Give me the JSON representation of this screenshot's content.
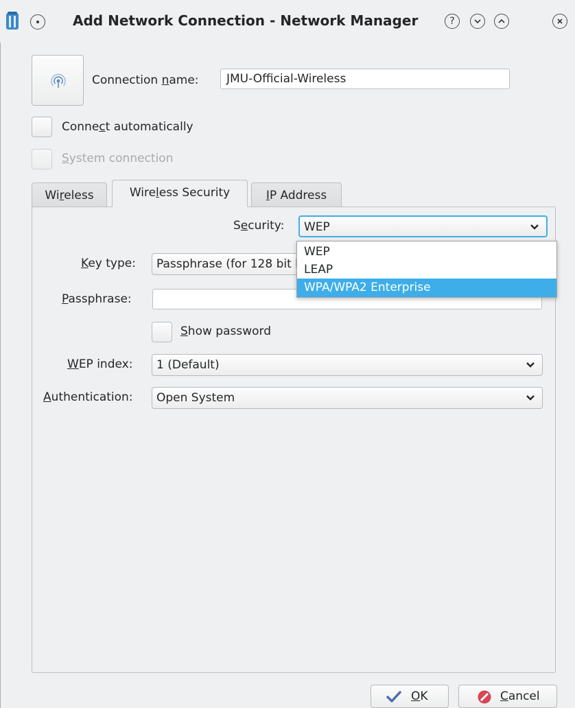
{
  "titlebar": {
    "title": "Add Network Connection - Network Manager",
    "buttons": [
      "?",
      "∨",
      "∧",
      "×"
    ]
  },
  "connection_name": {
    "label_pre": "Connection ",
    "label_u": "n",
    "label_post": "ame:",
    "value": "JMU-Official-Wireless"
  },
  "connect_auto": {
    "pre": "Conne",
    "u": "c",
    "post": "t automatically",
    "checked": false
  },
  "system_conn": {
    "pre": "",
    "u": "S",
    "post": "ystem connection",
    "checked": false,
    "enabled": false
  },
  "tabs": [
    {
      "pre": "Wi",
      "u": "r",
      "post": "eless",
      "active": false
    },
    {
      "pre": "Wire",
      "u": "l",
      "post": "ess Security",
      "active": true
    },
    {
      "pre": "",
      "u": "I",
      "post": "P Address",
      "active": false
    }
  ],
  "security": {
    "pre": "S",
    "u": "e",
    "post": "curity:",
    "value": "WEP"
  },
  "security_options": [
    "WEP",
    "LEAP",
    "WPA/WPA2 Enterprise"
  ],
  "security_highlighted": "WPA/WPA2 Enterprise",
  "key_type": {
    "pre": "",
    "u": "K",
    "post": "ey type:",
    "value": "Passphrase (for 128 bit key)"
  },
  "passphrase": {
    "pre": "",
    "u": "P",
    "post": "assphrase:",
    "value": ""
  },
  "show_password": {
    "pre": "",
    "u": "S",
    "post": "how password",
    "checked": false
  },
  "wep_index": {
    "pre": "",
    "u": "W",
    "post": "EP index:",
    "value": "1 (Default)"
  },
  "authentication": {
    "pre": "",
    "u": "A",
    "post": "uthentication:",
    "value": "Open System"
  },
  "footer": {
    "ok": {
      "pre": "",
      "u": "O",
      "post": "K"
    },
    "cancel": {
      "pre": "",
      "u": "C",
      "post": "ancel"
    }
  },
  "colors": {
    "accent": "#3daee9",
    "cancel_icon": "#da4453",
    "ok_icon": "#4d6fa8"
  }
}
